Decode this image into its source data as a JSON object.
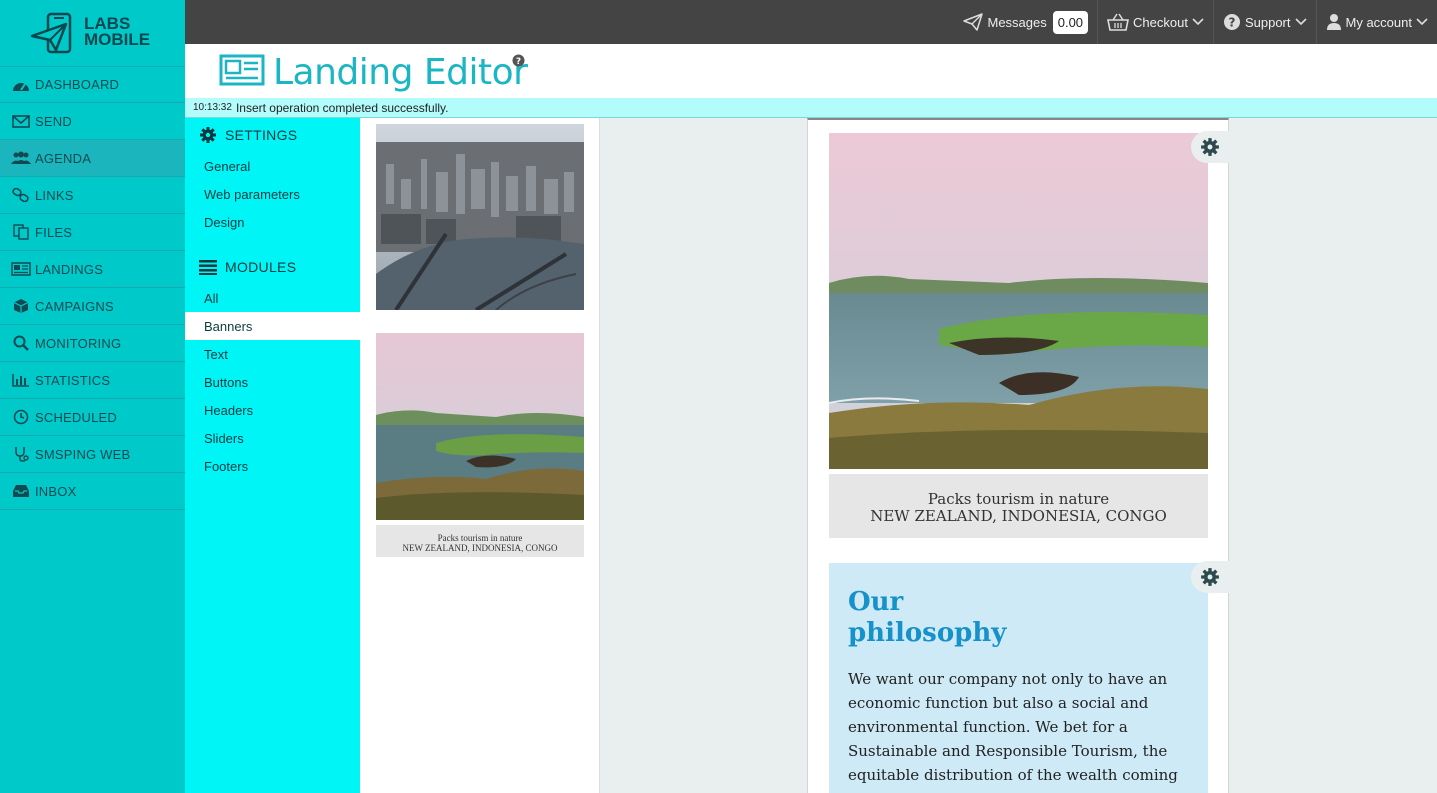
{
  "logo": {
    "line1": "LABS",
    "line2": "MOBILE"
  },
  "nav": {
    "items": [
      {
        "label": "DASHBOARD",
        "icon": "dashboard-icon"
      },
      {
        "label": "SEND",
        "icon": "envelope-icon"
      },
      {
        "label": "AGENDA",
        "icon": "users-icon",
        "active": true
      },
      {
        "label": "LINKS",
        "icon": "link-icon"
      },
      {
        "label": "FILES",
        "icon": "files-icon"
      },
      {
        "label": "LANDINGS",
        "icon": "newspaper-icon"
      },
      {
        "label": "CAMPAIGNS",
        "icon": "cube-icon"
      },
      {
        "label": "MONITORING",
        "icon": "search-icon"
      },
      {
        "label": "STATISTICS",
        "icon": "bar-chart-icon"
      },
      {
        "label": "SCHEDULED",
        "icon": "clock-icon"
      },
      {
        "label": "SMSPING WEB",
        "icon": "stethoscope-icon"
      },
      {
        "label": "INBOX",
        "icon": "inbox-icon"
      }
    ]
  },
  "topbar": {
    "messages_label": "Messages",
    "messages_balance": "0.00",
    "checkout_label": "Checkout",
    "support_label": "Support",
    "account_label": "My account"
  },
  "header": {
    "title": "Landing Editor"
  },
  "status": {
    "time": "10:13:32",
    "message": "Insert operation completed successfully."
  },
  "panel": {
    "settings_heading": "SETTINGS",
    "settings_items": [
      "General",
      "Web parameters",
      "Design"
    ],
    "modules_heading": "MODULES",
    "modules_items": [
      "All",
      "Banners",
      "Text",
      "Buttons",
      "Headers",
      "Sliders",
      "Footers"
    ],
    "active_module": "Banners"
  },
  "thumbnails": {
    "banner2_caption_line1": "Packs tourism in nature",
    "banner2_caption_line2": "NEW ZEALAND, INDONESIA, CONGO"
  },
  "page": {
    "banner_caption_line1": "Packs tourism in nature",
    "banner_caption_line2": "NEW ZEALAND, INDONESIA, CONGO",
    "philosophy_title_line1": "Our",
    "philosophy_title_line2": "philosophy",
    "philosophy_body": "We want our company not only to have an economic function but also a social and environmental function. We bet for a Sustainable and Responsible Tourism, the equitable distribution of the wealth coming"
  },
  "colors": {
    "sidebar": "#00c9c9",
    "topbar": "#444444",
    "accent": "#1ab6c4",
    "status_bg": "#b3fcfc",
    "panel_bg": "#00f6f6",
    "philosophy_bg": "#cdeaf6",
    "philosophy_title": "#1791c9"
  }
}
